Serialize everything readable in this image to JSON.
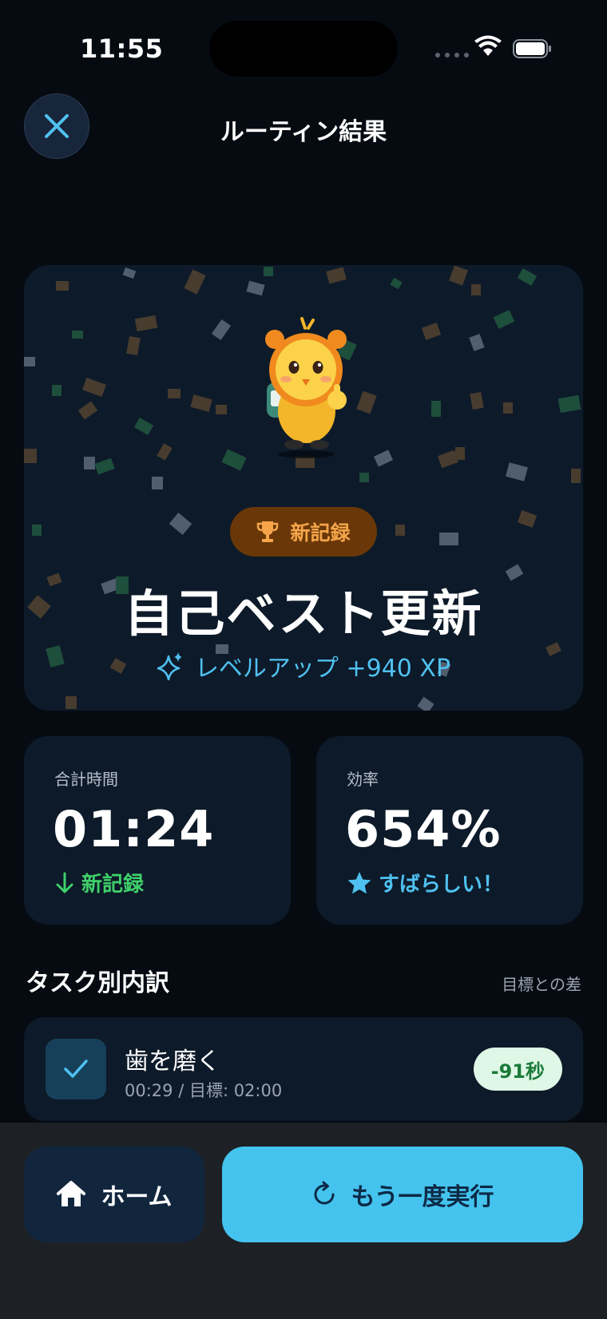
{
  "status_bar": {
    "time": "11:55"
  },
  "header": {
    "title": "ルーティン結果",
    "close_icon": "close-icon"
  },
  "hero": {
    "badge_icon": "trophy-icon",
    "badge_label": "新記録",
    "title": "自己ベスト更新",
    "xp_icon": "sparkles-icon",
    "xp_text": "レベルアップ +940 XP"
  },
  "stats": [
    {
      "label": "合計時間",
      "value": "01:24",
      "foot_icon": "arrow-down-icon",
      "foot_text": "新記録"
    },
    {
      "label": "効率",
      "value": "654%",
      "foot_icon": "star-icon",
      "foot_text": "すばらしい！"
    }
  ],
  "breakdown": {
    "title": "タスク別内訳",
    "aside": "目標との差",
    "tasks": [
      {
        "name": "歯を磨く",
        "meta": "00:29 / 目標: 02:00",
        "diff": "-91秒",
        "checked": true
      }
    ]
  },
  "actions": {
    "home_label": "ホーム",
    "home_icon": "home-icon",
    "again_label": "もう一度実行",
    "again_icon": "refresh-icon"
  },
  "colors": {
    "background": "#060b12",
    "card": "#0d1a29",
    "accent": "#44c3ee",
    "success": "#3fd06a",
    "badge_bg": "#6a3808",
    "badge_text": "#f6a54a"
  }
}
